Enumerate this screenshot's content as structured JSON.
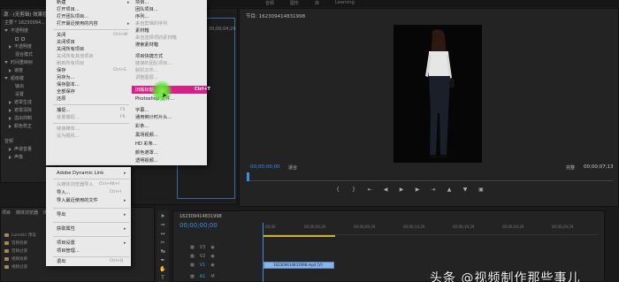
{
  "topbar": {
    "tabs": [
      "音频",
      "图形",
      "库",
      "Learning"
    ]
  },
  "effect_controls": {
    "header": "源 · (无剪辑)",
    "sub_header": "效果控件",
    "master_label": "主要 * 16230094...",
    "rows": [
      {
        "label": "不透明度",
        "level": 1
      },
      {
        "label": "不透明度",
        "level": 2
      },
      {
        "label": "混合模式",
        "level": 2
      },
      {
        "label": "时间重映射",
        "level": 1
      },
      {
        "label": "速度",
        "level": 2
      },
      {
        "label": "超级键",
        "level": 1
      },
      {
        "label": "输出",
        "level": 2
      },
      {
        "label": "设置",
        "level": 2
      },
      {
        "label": "遮罩生成",
        "level": 2
      },
      {
        "label": "遮罩清除",
        "level": 2
      },
      {
        "label": "溢出抑制",
        "level": 2
      },
      {
        "label": "颜色校正",
        "level": 2
      }
    ],
    "audio_label": "音频",
    "audio_rows": [
      "声道音量",
      "声像"
    ]
  },
  "source": {
    "timecode": "00;00;04;29"
  },
  "program": {
    "title": "节目: 1623094148319​98",
    "timecode_left": "00;00;00;00",
    "fit": "适合",
    "resolution": "完整",
    "timecode_right": "00;00;07;13"
  },
  "menu": {
    "left_items": [
      {
        "label": "新建",
        "shortcut": "",
        "disabled": false
      },
      {
        "label": "打开项目...",
        "shortcut": "",
        "disabled": false
      },
      {
        "label": "打开团队项目...",
        "shortcut": "",
        "disabled": false
      },
      {
        "label": "打开最近使用的内容",
        "shortcut": "",
        "disabled": false
      },
      {
        "label": "关闭",
        "shortcut": "Ctrl+W",
        "disabled": false
      },
      {
        "label": "关闭项目",
        "shortcut": "",
        "disabled": false
      },
      {
        "label": "关闭所有项目",
        "shortcut": "",
        "disabled": false
      },
      {
        "label": "关闭所有其他项目",
        "shortcut": "",
        "disabled": true
      },
      {
        "label": "刷新所有项目",
        "shortcut": "",
        "disabled": true
      },
      {
        "label": "保存",
        "shortcut": "Ctrl+S",
        "disabled": false
      },
      {
        "label": "另存为...",
        "shortcut": "",
        "disabled": false
      },
      {
        "label": "保存副本...",
        "shortcut": "",
        "disabled": false
      },
      {
        "label": "全部保存",
        "shortcut": "",
        "disabled": false
      },
      {
        "label": "还原",
        "shortcut": "",
        "disabled": false
      },
      {
        "label": "捕捉...",
        "shortcut": "F5",
        "disabled": false
      },
      {
        "label": "批量捕捉...",
        "shortcut": "F6",
        "disabled": true
      },
      {
        "label": "链接媒体...",
        "shortcut": "",
        "disabled": true
      },
      {
        "label": "设为脱机...",
        "shortcut": "",
        "disabled": true
      }
    ],
    "right_items": [
      {
        "label": "项目...",
        "disabled": false
      },
      {
        "label": "团队项目...",
        "disabled": false
      },
      {
        "label": "序列...",
        "disabled": false
      },
      {
        "label": "来自剪辑的序列",
        "disabled": true
      },
      {
        "label": "素材箱",
        "disabled": false
      },
      {
        "label": "来自选择项的素材箱",
        "disabled": true
      },
      {
        "label": "搜索素材箱",
        "disabled": false
      },
      {
        "label": "项目快捷方式",
        "disabled": false
      },
      {
        "label": "链接的团队项目...",
        "disabled": true
      },
      {
        "label": "脱机文件...",
        "disabled": true
      },
      {
        "label": "调整图层...",
        "disabled": true
      },
      {
        "label": "旧版标题...",
        "disabled": false
      },
      {
        "label": "Photoshop 文件...",
        "disabled": false
      },
      {
        "label": "字幕...",
        "disabled": false
      },
      {
        "label": "通用倒计时片头...",
        "disabled": false
      },
      {
        "label": "彩条...",
        "disabled": false
      },
      {
        "label": "黑场视频...",
        "disabled": false
      },
      {
        "label": "HD 彩条...",
        "disabled": false
      },
      {
        "label": "颜色遮罩...",
        "disabled": false
      },
      {
        "label": "透明视频...",
        "disabled": false
      }
    ],
    "highlighted": {
      "label": "旧版标题...",
      "shortcut": "Ctrl+T"
    }
  },
  "submenu": {
    "items": [
      {
        "label": "Adobe Dynamic Link",
        "shortcut": "",
        "arrow": true,
        "disabled": false
      },
      {
        "label": "从媒体浏览器导入",
        "shortcut": "Ctrl+Alt+I",
        "arrow": false,
        "disabled": true
      },
      {
        "label": "导入...",
        "shortcut": "Ctrl+I",
        "arrow": false,
        "disabled": false
      },
      {
        "label": "导入最近使用的文件",
        "shortcut": "",
        "arrow": true,
        "disabled": false
      },
      {
        "label": "导出",
        "shortcut": "",
        "arrow": true,
        "disabled": false
      },
      {
        "label": "获取属性",
        "shortcut": "",
        "arrow": true,
        "disabled": false
      },
      {
        "label": "项目设置",
        "shortcut": "",
        "arrow": true,
        "disabled": false
      },
      {
        "label": "项目管理...",
        "shortcut": "",
        "arrow": false,
        "disabled": false
      },
      {
        "label": "退出",
        "shortcut": "Ctrl+Q",
        "arrow": false,
        "disabled": false
      }
    ]
  },
  "project": {
    "tabs": [
      "项目",
      "媒体浏览器",
      "库",
      "信息"
    ],
    "items": [
      "Lumetri 预设",
      "音频效果",
      "音频过渡",
      "视频效果",
      "视频过渡"
    ]
  },
  "timeline": {
    "title": "1623094148319​98",
    "timecode": "00;00;00;00",
    "ticks": [
      "00;00",
      "00;00;04;29",
      "00;00;09;29",
      "00;00;14;29",
      "00;00;19;29",
      "00;00;24;29",
      "00;00;29;29"
    ],
    "tracks": [
      "V3",
      "V2",
      "V1",
      "A1"
    ],
    "clip_label": "1623094148319​98.mp4 [V]"
  },
  "watermark": "头条 @视频制作那些事儿",
  "colors": {
    "accent_blue": "#3e8ee6",
    "highlight_pink": "#d81f86",
    "work_area_yellow": "#c9b32a",
    "clip_blue": "#8ab4e8"
  }
}
